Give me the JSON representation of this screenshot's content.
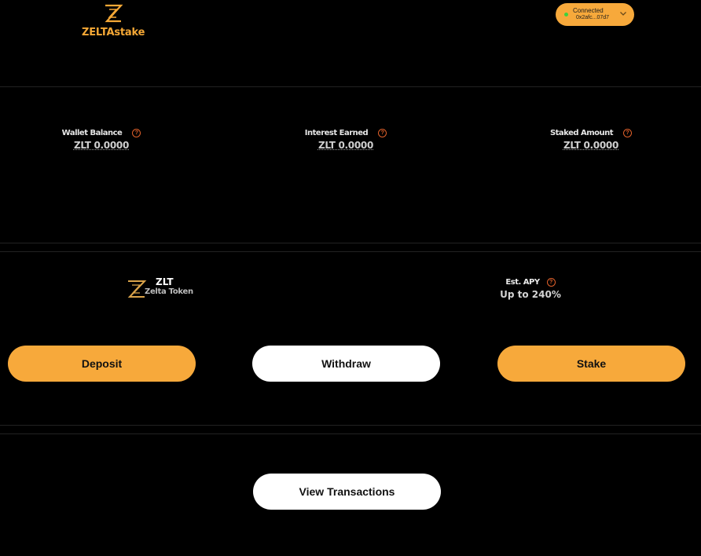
{
  "header": {
    "brand": "ZELTAstake",
    "wallet": {
      "status": "Connected",
      "address": "0x2afc...07d7",
      "status_color": "#3ed23e"
    }
  },
  "stats": [
    {
      "label": "Wallet Balance",
      "value": "ZLT 0.0000"
    },
    {
      "label": "Interest Earned",
      "value": "ZLT 0.0000"
    },
    {
      "label": "Staked Amount",
      "value": "ZLT 0.0000"
    }
  ],
  "token": {
    "symbol": "ZLT",
    "name": "Zelta Token"
  },
  "apy": {
    "label": "Est. APY",
    "value": "Up to 240%"
  },
  "actions": {
    "deposit": "Deposit",
    "withdraw": "Withdraw",
    "stake": "Stake"
  },
  "transactions": {
    "view_label": "View Transactions"
  },
  "colors": {
    "accent": "#f7a93b",
    "background": "#000000",
    "help_icon": "#e0602a"
  }
}
